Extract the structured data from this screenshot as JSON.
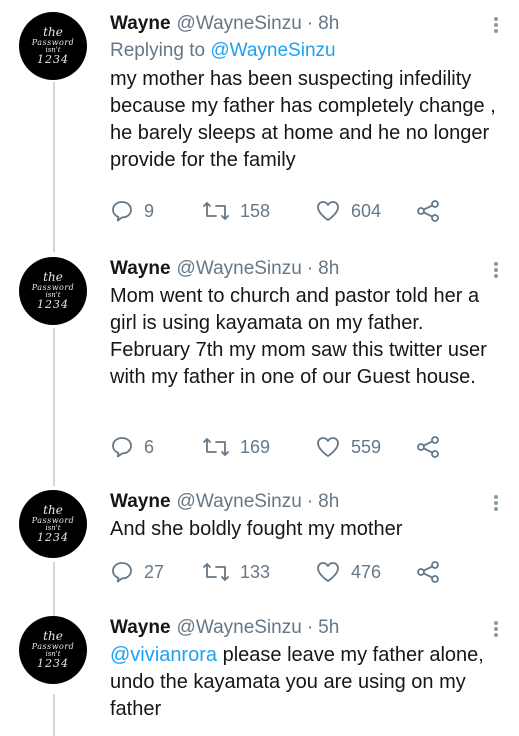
{
  "avatar_text": [
    "the",
    "Password",
    "isn't",
    "1234"
  ],
  "tweets": [
    {
      "name": "Wayne",
      "handle": "@WayneSinzu",
      "dot": "·",
      "time": "8h",
      "reply_prefix": "Replying to ",
      "reply_handle": "@WayneSinzu",
      "text": "my mother has been suspecting infedility because my father has completely change , he barely sleeps at home and he no longer provide for the family",
      "replies": "9",
      "retweets": "158",
      "likes": "604"
    },
    {
      "name": "Wayne",
      "handle": "@WayneSinzu",
      "dot": "·",
      "time": "8h",
      "text": "Mom went to church and pastor told her a girl is using kayamata on my father. February 7th my mom saw this twitter user with my father in one of our Guest house.",
      "replies": "6",
      "retweets": "169",
      "likes": "559"
    },
    {
      "name": "Wayne",
      "handle": "@WayneSinzu",
      "dot": "·",
      "time": "8h",
      "text": "And she boldly fought my mother",
      "replies": "27",
      "retweets": "133",
      "likes": "476"
    },
    {
      "name": "Wayne",
      "handle": "@WayneSinzu",
      "dot": "·",
      "time": "5h",
      "mention": "@vivianrora",
      "text": " please leave my father alone, undo the kayamata you are using on my father"
    }
  ],
  "icons": {
    "reply": "reply-icon",
    "retweet": "retweet-icon",
    "like": "heart-icon",
    "share": "share-icon",
    "more": "more-options-icon"
  },
  "colors": {
    "link": "#1da1f2",
    "secondary_text": "#657786",
    "thread_line": "#ccd6dd"
  }
}
